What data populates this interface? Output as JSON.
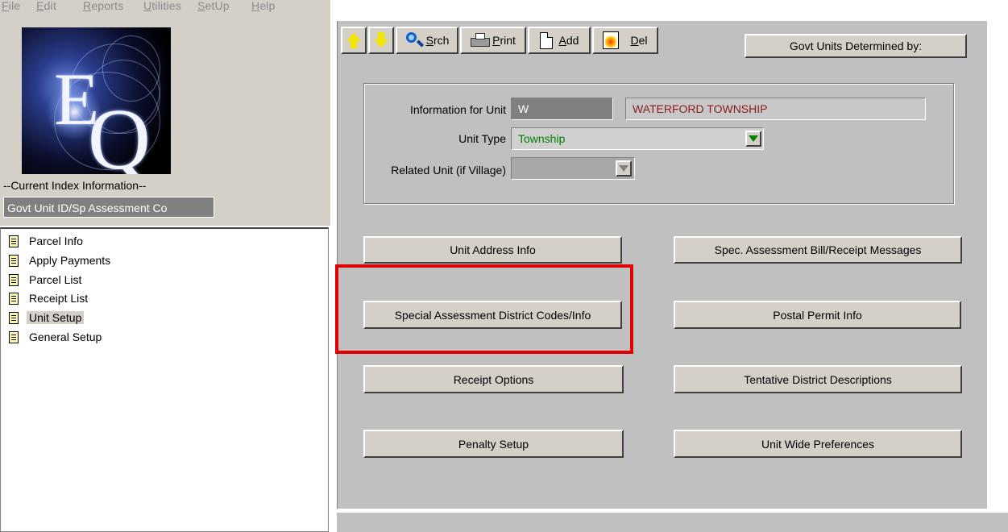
{
  "menu": {
    "items": [
      {
        "label": "File",
        "accel": "F",
        "rest": "ile"
      },
      {
        "label": "Edit",
        "accel": "E",
        "rest": "dit"
      },
      {
        "label": "Reports",
        "accel": "R",
        "rest": "eports"
      },
      {
        "label": "Utilities",
        "accel": "U",
        "rest": "tilities"
      },
      {
        "label": "SetUp",
        "accel": "S",
        "rest": "etUp"
      },
      {
        "label": "Help",
        "accel": "H",
        "rest": "elp"
      }
    ]
  },
  "logo": {
    "letters": [
      "E",
      "Q"
    ]
  },
  "index": {
    "label": "--Current Index Information--",
    "value": "Govt Unit ID/Sp Assessment Co"
  },
  "tree": {
    "items": [
      {
        "label": "Parcel Info"
      },
      {
        "label": "Apply Payments"
      },
      {
        "label": "Parcel List"
      },
      {
        "label": "Receipt List"
      },
      {
        "label": "Unit Setup",
        "selected": true
      },
      {
        "label": "General Setup"
      }
    ]
  },
  "toolbar": {
    "srch_accel": "S",
    "srch_rest": "rch",
    "print_accel": "P",
    "print_rest": "rint",
    "add_accel": "A",
    "add_rest": "dd",
    "del_accel": "D",
    "del_rest": "el",
    "govt_units_label": "Govt Units Determined by:"
  },
  "unit": {
    "info_label": "Information for Unit",
    "code": "W",
    "name": "WATERFORD TOWNSHIP",
    "type_label": "Unit Type",
    "type_value": "Township",
    "related_label": "Related Unit (if Village)",
    "related_value": ""
  },
  "buttons": {
    "unit_address": "Unit Address Info",
    "spec_bill_messages": "Spec. Assessment Bill/Receipt  Messages",
    "special_district_codes": "Special Assessment District Codes/Info",
    "postal_permit": "Postal Permit Info",
    "receipt_options": "Receipt Options",
    "tentative_district": "Tentative District Descriptions",
    "penalty_setup": "Penalty Setup",
    "unit_wide_prefs": "Unit Wide Preferences"
  },
  "colors": {
    "unit_name_text": "#8b1a1a",
    "unit_type_text": "#008000",
    "highlight_border": "#e00000",
    "panel_bg": "#c0c0c0",
    "arrow_yellow": "#f4e600"
  }
}
